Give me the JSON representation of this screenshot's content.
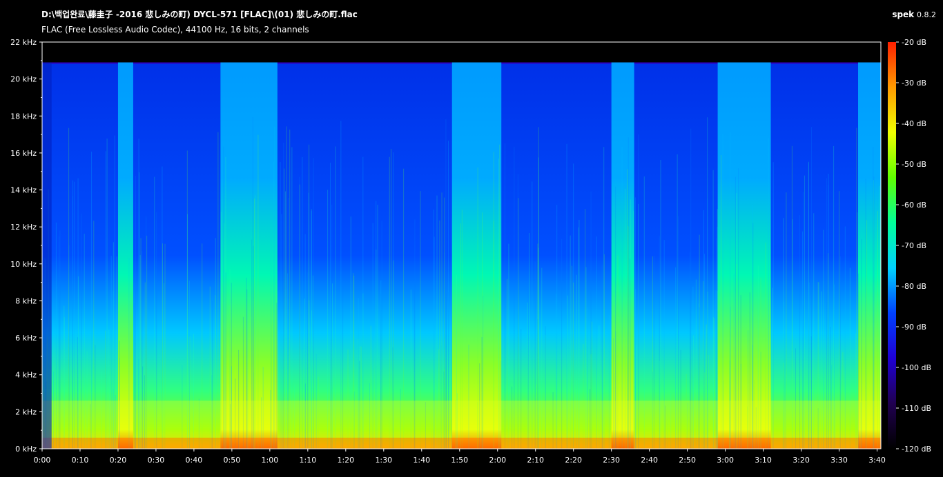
{
  "header": {
    "file_path": "D:\\백업완료\\藤圭子 -2016 悲しみの町) DYCL-571 [FLAC]\\(01) 悲しみの町.flac",
    "format_info": "FLAC (Free Lossless Audio Codec), 44100 Hz, 16 bits, 2 channels",
    "app_name": "spek",
    "app_version": "0.8.2"
  },
  "chart_data": {
    "type": "heatmap",
    "title": "D:\\백업완료\\藤圭子 -2016 悲しみの町) DYCL-571 [FLAC]\\(01) 悲しみの町.flac",
    "subtitle": "FLAC (Free Lossless Audio Codec), 44100 Hz, 16 bits, 2 channels",
    "x_ticks": [
      "0:00",
      "0:10",
      "0:20",
      "0:30",
      "0:40",
      "0:50",
      "1:00",
      "1:10",
      "1:20",
      "1:30",
      "1:40",
      "1:50",
      "2:00",
      "2:10",
      "2:20",
      "2:30",
      "2:40",
      "2:50",
      "3:00",
      "3:10",
      "3:20",
      "3:30",
      "3:40"
    ],
    "x_range_seconds": [
      0,
      221
    ],
    "y_ticks": [
      "0 kHz",
      "2 kHz",
      "4 kHz",
      "6 kHz",
      "8 kHz",
      "10 kHz",
      "12 kHz",
      "14 kHz",
      "16 kHz",
      "18 kHz",
      "20 kHz",
      "22 kHz"
    ],
    "y_range_khz": [
      0,
      22
    ],
    "lowpass_cutoff_khz": 20.9,
    "colorbar_ticks": [
      "-20 dB",
      "-30 dB",
      "-40 dB",
      "-50 dB",
      "-60 dB",
      "-70 dB",
      "-80 dB",
      "-90 dB",
      "-100 dB",
      "-110 dB",
      "-120 dB"
    ],
    "colorbar_range_db": [
      -120,
      -20
    ],
    "colormap": [
      "#000000",
      "#200050",
      "#1f00d4",
      "#0040ff",
      "#00d2ff",
      "#00ff9a",
      "#60ff00",
      "#f0ff00",
      "#ff9a00",
      "#ff2000"
    ],
    "loud_segments_seconds": [
      [
        20,
        24
      ],
      [
        47,
        62
      ],
      [
        108,
        121
      ],
      [
        150,
        156
      ],
      [
        178,
        192
      ],
      [
        215,
        221
      ]
    ]
  }
}
